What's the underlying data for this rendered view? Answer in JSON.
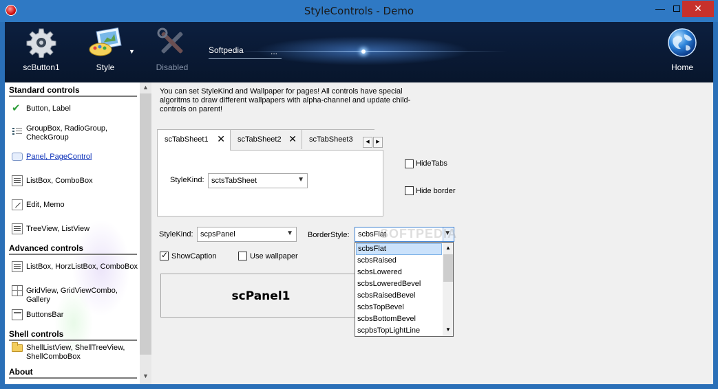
{
  "window": {
    "title": "StyleControls - Demo",
    "min": "—",
    "close": "✕"
  },
  "toolbar": {
    "button1": "scButton1",
    "style": "Style",
    "disabled": "Disabled",
    "home": "Home",
    "edit_value": "Softpedia",
    "edit_ellipsis": "...",
    "dropdown_arrow": "▼"
  },
  "sidebar": {
    "groups": [
      {
        "title": "Standard controls"
      },
      {
        "title": "Advanced controls"
      },
      {
        "title": "Shell controls"
      },
      {
        "title": "About"
      }
    ],
    "items": [
      {
        "label": "Button, Label",
        "icon": "check-icon"
      },
      {
        "label": "GroupBox, RadioGroup, CheckGroup",
        "icon": "group-icon"
      },
      {
        "label": "Panel, PageControl",
        "icon": "panel-icon"
      },
      {
        "label": "ListBox, ComboBox",
        "icon": "listbox-icon"
      },
      {
        "label": "Edit, Memo",
        "icon": "edit-icon"
      },
      {
        "label": "TreeView, ListView",
        "icon": "treeview-icon"
      },
      {
        "label": "ListBox, HorzListBox, ComboBox",
        "icon": "listbox-icon"
      },
      {
        "label": "GridView, GridViewCombo, Gallery",
        "icon": "grid-icon"
      },
      {
        "label": "ButtonsBar",
        "icon": "buttonsbar-icon"
      },
      {
        "label": "ShellListView, ShellTreeView, ShellComboBox",
        "icon": "folder-icon"
      }
    ],
    "check_glyph": "✔",
    "scroll_up": "▲",
    "scroll_down": "▼"
  },
  "main": {
    "description": "You can set StyleKind and Wallpaper for pages! All controls have special algoritms to draw different wallpapers with alpha-channel and update child-controls on parent!",
    "tabs": [
      {
        "label": "scTabSheet1",
        "close": "✕"
      },
      {
        "label": "scTabSheet2",
        "close": "✕"
      },
      {
        "label": "scTabSheet3"
      }
    ],
    "tab_scroll_left": "◀",
    "tab_scroll_right": "▶",
    "tab_stylekind_label": "StyleKind:",
    "tab_stylekind_value": "sctsTabSheet",
    "hide_tabs": "HideTabs",
    "hide_border": "Hide border",
    "panel_stylekind_label": "StyleKind:",
    "panel_stylekind_value": "scpsPanel",
    "borderstyle_label": "BorderStyle:",
    "borderstyle_value": "scbsFlat",
    "show_caption": "ShowCaption",
    "use_wallpaper": "Use wallpaper",
    "panel_caption": "scPanel1",
    "combo_arrow": "▼",
    "watermark": "SOFTPEDIA",
    "border_options": [
      "scbsFlat",
      "scbsRaised",
      "scbsLowered",
      "scbsLoweredBevel",
      "scbsRaisedBevel",
      "scbsTopBevel",
      "scbsBottomBevel",
      "scpbsTopLightLine"
    ],
    "list_up": "▲",
    "list_down": "▼"
  }
}
